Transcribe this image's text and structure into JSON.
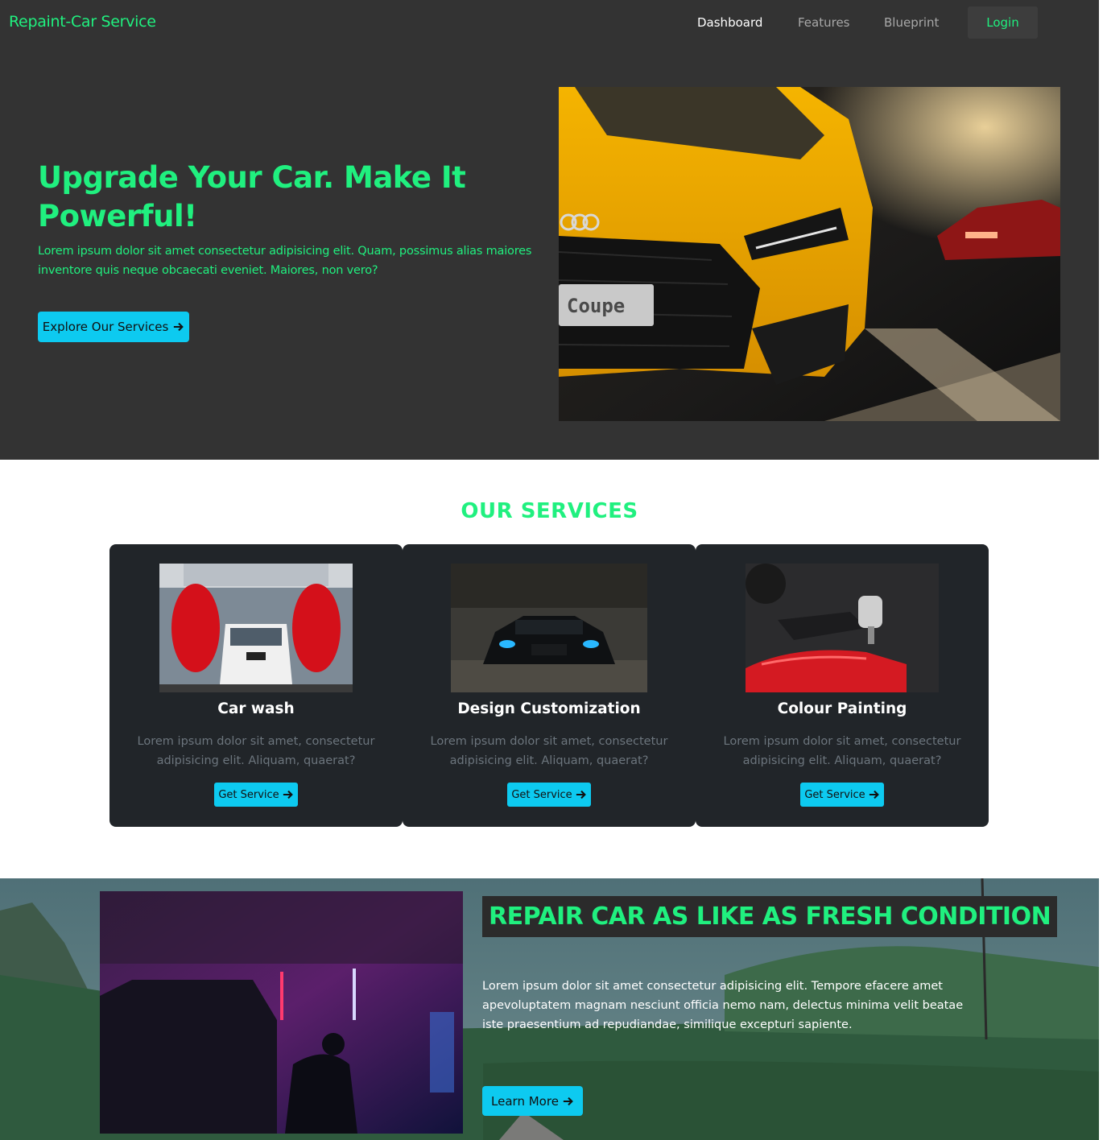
{
  "navbar": {
    "brand": "Repaint-Car Service",
    "links": [
      {
        "label": "Dashboard",
        "active": true
      },
      {
        "label": "Features",
        "active": false
      },
      {
        "label": "Blueprint",
        "active": false
      }
    ],
    "login_label": "Login"
  },
  "hero": {
    "title": "Upgrade Your Car. Make It Powerful!",
    "text": "Lorem ipsum dolor sit amet consectetur adipisicing elit. Quam, possimus alias maiores inventore quis neque obcaecati eveniet. Maiores, non vero?",
    "button_label": "Explore Our Services",
    "button_icon": "arrow-right-icon",
    "image_plate_text": "Coupe"
  },
  "services": {
    "title": "OUR SERVICES",
    "cards": [
      {
        "title": "Car wash",
        "text": "Lorem ipsum dolor sit amet, consectetur adipisicing elit. Aliquam, quaerat?",
        "button_label": "Get Service"
      },
      {
        "title": "Design Customization",
        "text": "Lorem ipsum dolor sit amet, consectetur adipisicing elit. Aliquam, quaerat?",
        "button_label": "Get Service"
      },
      {
        "title": "Colour Painting",
        "text": "Lorem ipsum dolor sit amet, consectetur adipisicing elit. Aliquam, quaerat?",
        "button_label": "Get Service"
      }
    ]
  },
  "repair": {
    "title": "REPAIR CAR AS LIKE AS FRESH CONDITION",
    "text": "Lorem ipsum dolor sit amet consectetur adipisicing elit. Tempore efacere amet apevoluptatem magnam nesciunt officia nemo nam, delectus minima velit beatae iste praesentium ad repudiandae, similique excepturi sapiente.",
    "button_label": "Learn More"
  },
  "colors": {
    "accent_green": "#20f07f",
    "button_cyan": "#0dcaf0",
    "dark_bg": "#333333",
    "card_bg": "#212529"
  }
}
